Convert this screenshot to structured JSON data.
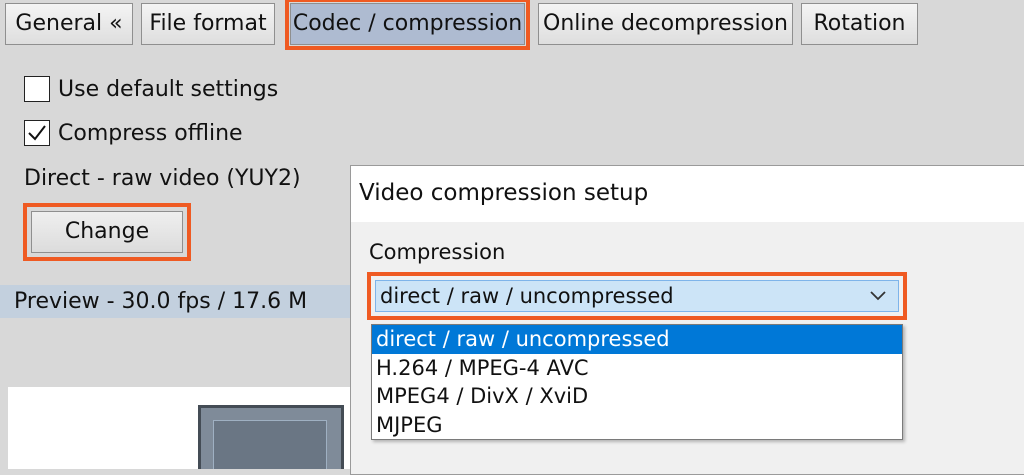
{
  "tabs": [
    {
      "label": "General «",
      "active": false
    },
    {
      "label": "File format",
      "active": false
    },
    {
      "label": "Codec / compression",
      "active": true
    },
    {
      "label": "Online decompression",
      "active": false
    },
    {
      "label": "Rotation",
      "active": false
    }
  ],
  "options": {
    "use_default_label": "Use default settings",
    "use_default_checked": false,
    "compress_offline_label": "Compress offline",
    "compress_offline_checked": true
  },
  "codec_name": "Direct - raw video (YUY2)",
  "change_button": "Change",
  "preview_text": "Preview  -  30.0 fps / 17.6 M",
  "dialog": {
    "title": "Video compression setup",
    "compression_label": "Compression",
    "selected": "direct / raw / uncompressed",
    "items": [
      "direct / raw / uncompressed",
      "H.264 / MPEG-4 AVC",
      "MPEG4 / DivX / XviD",
      "MJPEG"
    ]
  },
  "colors": {
    "highlight": "#ef5a22",
    "selection": "#0078d7",
    "active_tab": "#aebbd1"
  }
}
